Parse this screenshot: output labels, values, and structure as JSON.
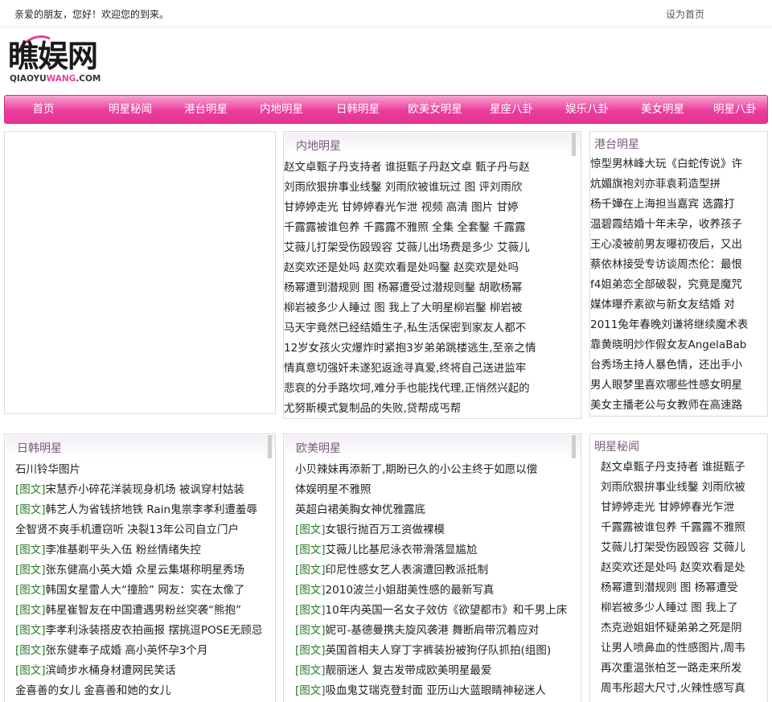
{
  "topbar": {
    "welcome": "亲爱的朋友，您好！欢迎您的到来。",
    "set_home": "设为首页"
  },
  "logo": {
    "main_a": "瞧娱",
    "main_b": "网",
    "sub_a": "QIAOYU",
    "sub_b": "WANG",
    "sub_c": ".COM"
  },
  "nav": {
    "items": [
      "首页",
      "明星秘闻",
      "港台明星",
      "内地明星",
      "日韩明星",
      "欧美女明星",
      "星座八卦",
      "娱乐八卦",
      "美女明星",
      "明星八卦"
    ]
  },
  "neidi": {
    "title": "内地明星",
    "lines": [
      "赵文卓甄子丹支持者  谁挺甄子丹赵文卓  甄子丹与赵",
      "刘雨欣狠拚事业线鑿  刘雨欣被谁玩过  图  评刘雨欣",
      "甘婷婷走光  甘婷婷春光乍泄  视频  高清  图片  甘婷",
      "千露露被谁包养  千露露不雅照  全集  全套鑿  千露露",
      "艾薇儿打架受伤殴毁容  艾薇儿出场费是多少  艾薇儿",
      "赵奕欢还是处吗  赵奕欢看是处吗鑿  赵奕欢是处吗",
      "杨幂遭到潜规则  图  杨幂遭受过潜规则鑿  胡歌杨幂",
      "柳岩被多少人睡过  图  我上了大明星柳岩鑿  柳岩被",
      "马天宇竟然已经结婚生子,私生活保密到家友人都不",
      "12岁女孩火灾爆炸时紧抱3岁弟弟跳楼逃生,至亲之情",
      "情真意切强奸未遂犯返途寻真爱,终将自己送进监牢",
      "悲哀的分手路坎坷,难分手也能找代理,正悄然兴起的",
      "尤努斯模式复制品的失败,贷帮成丐帮"
    ]
  },
  "gangtai": {
    "title": "港台明星",
    "lines": [
      "惊型男林峰大玩《白蛇传说》许",
      "炕媚旗袍刘亦菲袁莉造型拼",
      "杨千嬅在上海担当嘉宾  选露打",
      "温碧霞结婚十年未孕，收养孩子",
      "王心凌被前男友曝初夜后，又出",
      "蔡依林接受专访谈周杰伦：最恨",
      "f4姐弟恋全部破裂，究竟是魔咒",
      "媒体曝乔素欲与新女友结婚  对",
      "2011兔年春晚刘谦将继续魔术表",
      "靠黄晓明炒作假女友AngelaBab",
      "台秀场主持人暴色情，还出手小",
      "男人眼梦里喜欢哪些性感女明星",
      "美女主播老公与女教师在高速路"
    ]
  },
  "rihan": {
    "title": "日韩明星",
    "lines": [
      {
        "tag": "",
        "text": "石川铃华图片"
      },
      {
        "tag": "[图文]",
        "text": "宋慧乔小碎花洋装现身机场  被讽穿村姑装"
      },
      {
        "tag": "[图文]",
        "text": "韩艺人为省钱挤地铁  Rain鬼祟李孝利遭羞辱"
      },
      {
        "tag": "",
        "text": "全智贤不爽手机遭窃听  决裂13年公司自立门户"
      },
      {
        "tag": "[图文]",
        "text": "李准基剃平头入伍  粉丝情绪失控"
      },
      {
        "tag": "[图文]",
        "text": "张东健高小英大婚  众星云集堪称明星秀场"
      },
      {
        "tag": "[图文]",
        "text": "韩国女星雷人大“撞脸”  网友：实在太像了"
      },
      {
        "tag": "[图文]",
        "text": "韩星崔智友在中国遭遇男粉丝突袭“熊抱”"
      },
      {
        "tag": "[图文]",
        "text": "李孝利泳装搭皮衣拍画报  摆挑逗POSE无顾忌"
      },
      {
        "tag": "[图文]",
        "text": "张东健奉子成婚  高小英怀孕3个月"
      },
      {
        "tag": "[图文]",
        "text": "滨崎步水桶身材遭网民笑话"
      },
      {
        "tag": "",
        "text": "金喜善的女儿  金喜善和她的女儿"
      }
    ]
  },
  "oumei": {
    "title": "欧美明星",
    "lines": [
      {
        "tag": "",
        "text": "小贝辣妹再添新丁,期盼已久的小公主终于如愿以偿"
      },
      {
        "tag": "",
        "text": "体娱明星不雅照"
      },
      {
        "tag": "",
        "text": "英超白裙美胸女神优雅露底"
      },
      {
        "tag": "[图文]",
        "text": "女银行抛百万工资做裸模"
      },
      {
        "tag": "[图文]",
        "text": "艾薇儿比基尼泳衣带滑落显尴尬"
      },
      {
        "tag": "[图文]",
        "text": "印尼性感女艺人表演遭回教派抵制"
      },
      {
        "tag": "[图文]",
        "text": "2010波兰小姐甜美性感的最新写真"
      },
      {
        "tag": "[图文]",
        "text": "10年内英国一名女子效仿《欲望都市》和千男上床"
      },
      {
        "tag": "[图文]",
        "text": "妮可-基德曼携夫旋风袭港  舞断肩带沉着应对"
      },
      {
        "tag": "[图文]",
        "text": "英国首相夫人穿丁字裤装扮被狗仔队抓拍(组图)"
      },
      {
        "tag": "[图文]",
        "text": "靓丽迷人  复古发带成欧美明星最爱"
      },
      {
        "tag": "[图文]",
        "text": "吸血鬼艾瑞克登封面  亚历山大蓝眼睛神秘迷人"
      }
    ]
  },
  "mingxing": {
    "title": "明星秘闻",
    "lines": [
      "赵文卓甄子丹支持者  谁挺甄子",
      "刘雨欣狠拚事业线鑿  刘雨欣被",
      "甘婷婷走光  甘婷婷春光乍泄",
      "千露露被谁包养  千露露不雅照",
      "艾薇儿打架受伤殴毁容  艾薇儿",
      "赵奕欢还是处吗  赵奕欢看是处",
      "杨幂遭到潜规则  图  杨幂遭受",
      "柳岩被多少人睡过  图  我上了",
      "杰克逊姐姐怀疑弟弟之死是阴",
      "让男人喷鼻血的性感图片,周韦",
      "再次重温张柏芝一路走来所发",
      "周韦彤超大尺寸,火辣性感写真"
    ]
  }
}
